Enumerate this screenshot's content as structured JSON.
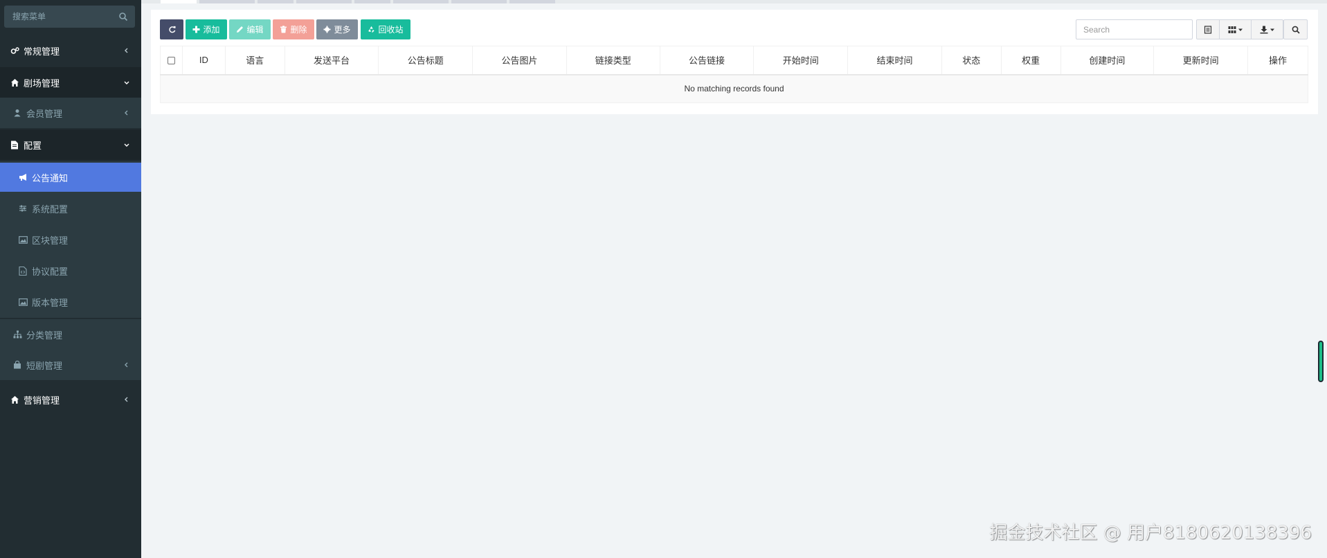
{
  "sidebar": {
    "search_placeholder": "搜索菜单",
    "items": [
      {
        "label": "常规管理"
      },
      {
        "label": "剧场管理"
      },
      {
        "label": "会员管理"
      },
      {
        "label": "配置"
      },
      {
        "label": "公告通知"
      },
      {
        "label": "系统配置"
      },
      {
        "label": "区块管理"
      },
      {
        "label": "协议配置"
      },
      {
        "label": "版本管理"
      },
      {
        "label": "分类管理"
      },
      {
        "label": "短剧管理"
      },
      {
        "label": "营销管理"
      }
    ]
  },
  "toolbar": {
    "add_label": "添加",
    "edit_label": "编辑",
    "delete_label": "删除",
    "more_label": "更多",
    "recycle_label": "回收站",
    "search_placeholder": "Search"
  },
  "table": {
    "columns": [
      "ID",
      "语言",
      "发送平台",
      "公告标题",
      "公告图片",
      "链接类型",
      "公告链接",
      "开始时间",
      "结束时间",
      "状态",
      "权重",
      "创建时间",
      "更新时间",
      "操作"
    ],
    "empty_text": "No matching records found"
  },
  "watermark": "掘金技术社区 @ 用户8180620138396",
  "colors": {
    "sidebar_bg": "#222d32",
    "active_item": "#5179e0",
    "success": "#18bc9c",
    "danger": "#f3a097",
    "primary_dark": "#444c69"
  }
}
